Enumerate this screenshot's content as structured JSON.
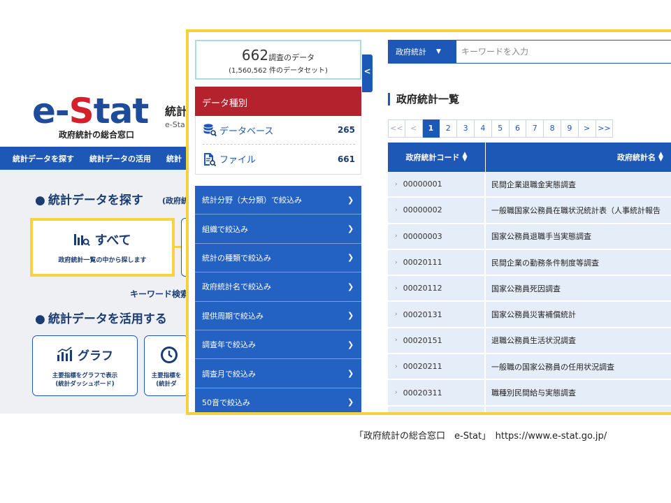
{
  "background": {
    "logo": {
      "prefix": "e-",
      "s": "S",
      "rest": "tat"
    },
    "logo_tagline": "政府統計の総合窓口",
    "site_title": "統計",
    "site_subtitle": "e-Sta",
    "nav": [
      "統計データを探す",
      "統計データの活用",
      "統計"
    ],
    "section_find": "統計データを探す",
    "section_find_note": "(政府統",
    "all_card": {
      "title": "すべて",
      "subtitle": "政府統計一覧の中から探します"
    },
    "keyword_link": "キーワード検索",
    "section_use": "統計データを活用する",
    "use_cards": [
      {
        "title": "グラフ",
        "line1": "主要指標をグラフで表示",
        "line2": "(統計ダッシュボード)"
      },
      {
        "title": "",
        "line1": "主要指標を",
        "line2": "(統計ダ"
      }
    ]
  },
  "panel": {
    "count_number": "662",
    "count_unit": "調査のデータ",
    "count_datasets": "(1,560,562 件のデータセット)",
    "data_type_heading": "データ種別",
    "data_types": [
      {
        "label": "データベース",
        "count": "265",
        "icon": "database-search-icon"
      },
      {
        "label": "ファイル",
        "count": "661",
        "icon": "file-search-icon"
      }
    ],
    "collapse_icon": "chevron-left-icon",
    "filters": [
      "統計分野（大分類）で絞込み",
      "組織で絞込み",
      "統計の種類で絞込み",
      "政府統計名で絞込み",
      "提供周期で絞込み",
      "調査年で絞込み",
      "調査月で絞込み",
      "50音で絞込み"
    ],
    "search": {
      "select_value": "政府統計",
      "placeholder": "キーワードを入力"
    },
    "list_title": "政府統計一覧",
    "pagination": [
      "<<",
      "<",
      "1",
      "2",
      "3",
      "4",
      "5",
      "6",
      "7",
      "8",
      "9",
      ">",
      ">>"
    ],
    "current_page": "1",
    "table": {
      "headers": [
        "政府統計コード",
        "政府統計名"
      ],
      "rows": [
        {
          "code": "00000001",
          "name": "民間企業退職金実態調査"
        },
        {
          "code": "00000002",
          "name": "一般職国家公務員在職状況統計表（人事統計報告"
        },
        {
          "code": "00000003",
          "name": "国家公務員退職手当実態調査"
        },
        {
          "code": "00020111",
          "name": "民間企業の勤務条件制度等調査"
        },
        {
          "code": "00020112",
          "name": "国家公務員死因調査"
        },
        {
          "code": "00020131",
          "name": "国家公務員災害補償統計"
        },
        {
          "code": "00020151",
          "name": "退職公務員生活状況調査"
        },
        {
          "code": "00020211",
          "name": "一般職の国家公務員の任用状況調査"
        },
        {
          "code": "00020311",
          "name": "職種別民間給与実態調査"
        }
      ]
    }
  },
  "caption": "「政府統計の総合窓口　e-Stat」　https://www.e-stat.go.jp/",
  "colors": {
    "brand_blue": "#1d58b6",
    "accent_red": "#b4232d",
    "highlight_yellow": "#f5d23c"
  }
}
